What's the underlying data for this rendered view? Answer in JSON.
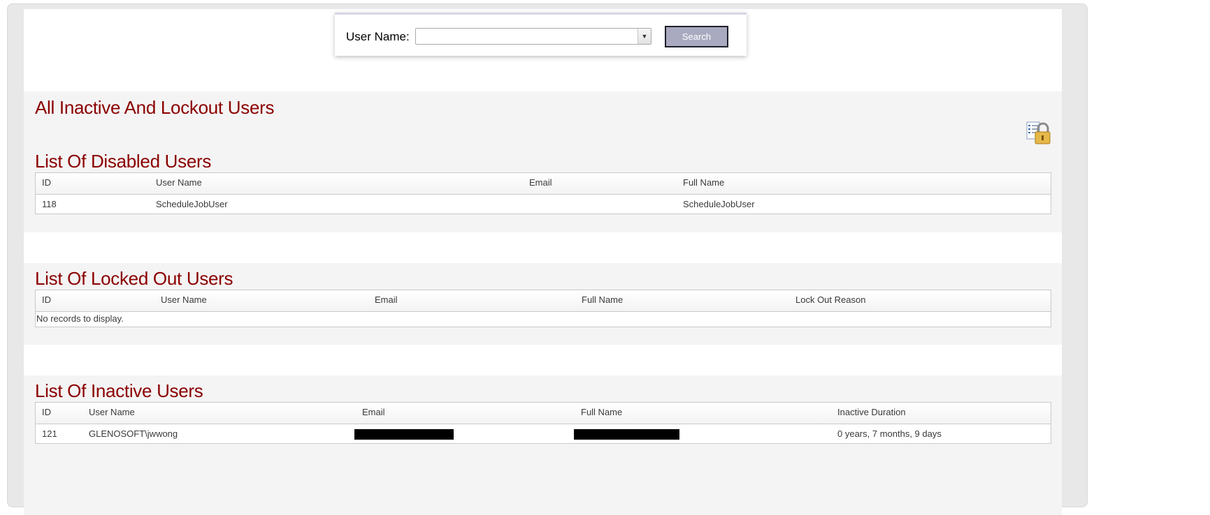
{
  "search": {
    "label": "User Name:",
    "value": "",
    "button_label": "Search"
  },
  "page_title": "All Inactive And Lockout Users",
  "disabled": {
    "title": "List Of Disabled Users",
    "columns": [
      "ID",
      "User Name",
      "Email",
      "Full Name"
    ],
    "rows": [
      {
        "id": "118",
        "user_name": "ScheduleJobUser",
        "email": "",
        "full_name": "ScheduleJobUser"
      }
    ]
  },
  "locked": {
    "title": "List Of Locked Out Users",
    "columns": [
      "ID",
      "User Name",
      "Email",
      "Full Name",
      "Lock Out Reason"
    ],
    "empty_text": "No records to display."
  },
  "inactive": {
    "title": "List Of Inactive Users",
    "columns": [
      "ID",
      "User Name",
      "Email",
      "Full Name",
      "Inactive Duration"
    ],
    "rows": [
      {
        "id": "121",
        "user_name": "GLENOSOFT\\jwwong",
        "email": "",
        "full_name": "",
        "inactive_duration": "0 years, 7 months, 9 days"
      }
    ]
  },
  "icons": {
    "lock": "user-list-lock-icon",
    "dropdown": "chevron-down-icon"
  },
  "colors": {
    "heading": "#8b0000",
    "button_bg": "#a9aac0"
  }
}
